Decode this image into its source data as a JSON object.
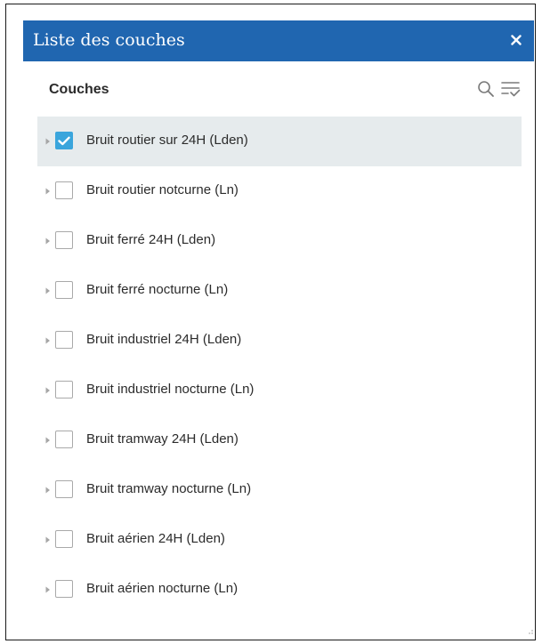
{
  "panel": {
    "title": "Liste des couches",
    "close_icon": "close-icon",
    "accent_color": "#2066b0"
  },
  "header": {
    "label": "Couches",
    "search_icon": "search-icon",
    "filter_icon": "filter-list-icon"
  },
  "colors": {
    "checked": "#3aa5dc",
    "selected_row": "#e6ebed",
    "checkbox_border": "#a9a9a9",
    "text": "#2b2b2b"
  },
  "layers": [
    {
      "label": "Bruit routier sur 24H (Lden)",
      "checked": true,
      "selected": true
    },
    {
      "label": "Bruit routier notcurne (Ln)",
      "checked": false,
      "selected": false
    },
    {
      "label": "Bruit ferré 24H (Lden)",
      "checked": false,
      "selected": false
    },
    {
      "label": "Bruit ferré nocturne (Ln)",
      "checked": false,
      "selected": false
    },
    {
      "label": "Bruit industriel 24H (Lden)",
      "checked": false,
      "selected": false
    },
    {
      "label": "Bruit industriel nocturne (Ln)",
      "checked": false,
      "selected": false
    },
    {
      "label": "Bruit tramway 24H (Lden)",
      "checked": false,
      "selected": false
    },
    {
      "label": "Bruit tramway nocturne (Ln)",
      "checked": false,
      "selected": false
    },
    {
      "label": "Bruit aérien 24H (Lden)",
      "checked": false,
      "selected": false
    },
    {
      "label": "Bruit aérien nocturne (Ln)",
      "checked": false,
      "selected": false
    }
  ]
}
